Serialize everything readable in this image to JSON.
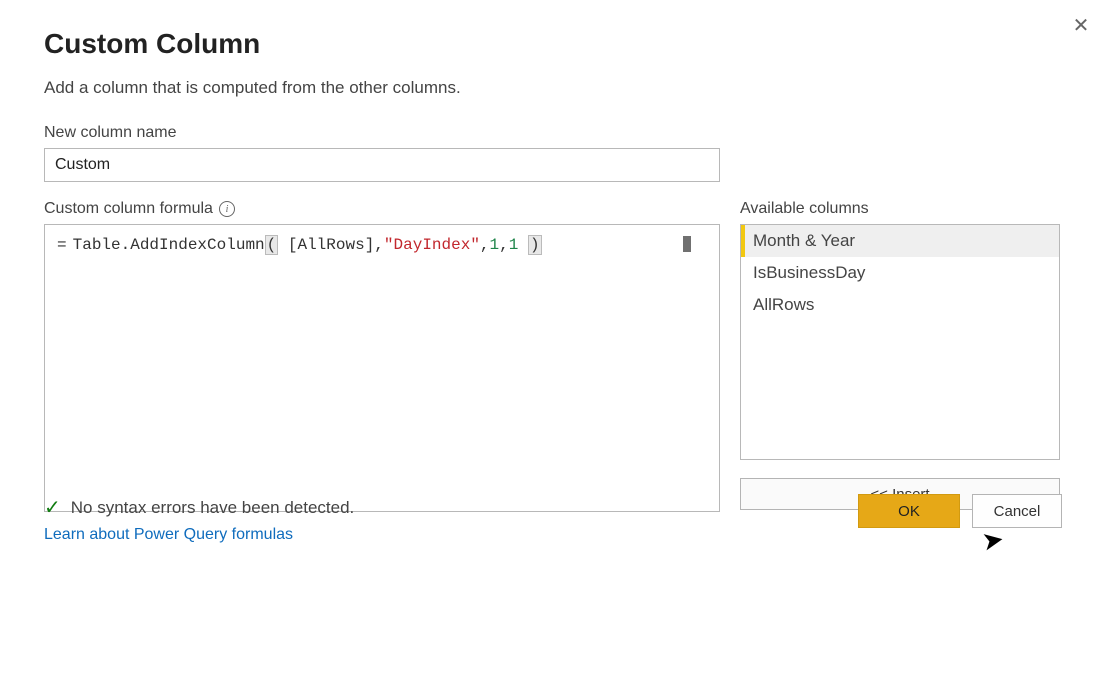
{
  "dialog": {
    "title": "Custom Column",
    "subtitle": "Add a column that is computed from the other columns."
  },
  "name_field": {
    "label": "New column name",
    "value": "Custom"
  },
  "formula": {
    "label": "Custom column formula",
    "prefix": "=",
    "func": "Table.AddIndexColumn",
    "bracket_open": "(",
    "arg1_open": "[",
    "arg1_name": "AllRows",
    "arg1_close": "]",
    "sep1": ", ",
    "arg2": "\"DayIndex\"",
    "sep2": ", ",
    "arg3": "1",
    "sep3": ", ",
    "arg4": "1",
    "bracket_close": ")"
  },
  "available": {
    "label": "Available columns",
    "items": [
      "Month & Year",
      "IsBusinessDay",
      "AllRows"
    ],
    "selected_index": 0
  },
  "buttons": {
    "insert": "<< Insert",
    "ok": "OK",
    "cancel": "Cancel"
  },
  "learn_link": "Learn about Power Query formulas",
  "status": {
    "message": "No syntax errors have been detected."
  }
}
